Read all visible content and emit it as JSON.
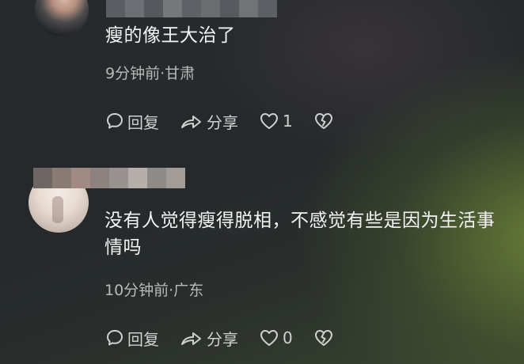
{
  "comments": [
    {
      "text": "瘦的像王大治了",
      "meta": "9分钟前·甘肃",
      "reply_label": "回复",
      "share_label": "分享",
      "like_count": "1"
    },
    {
      "text": "没有人觉得瘦得脱相，不感觉有些是因为生活事情吗",
      "meta": "10分钟前·广东",
      "reply_label": "回复",
      "share_label": "分享",
      "like_count": "0"
    }
  ],
  "icons": {
    "reply": "comment-bubble-icon",
    "share": "share-arrow-icon",
    "like": "heart-icon",
    "dislike": "broken-heart-icon"
  }
}
